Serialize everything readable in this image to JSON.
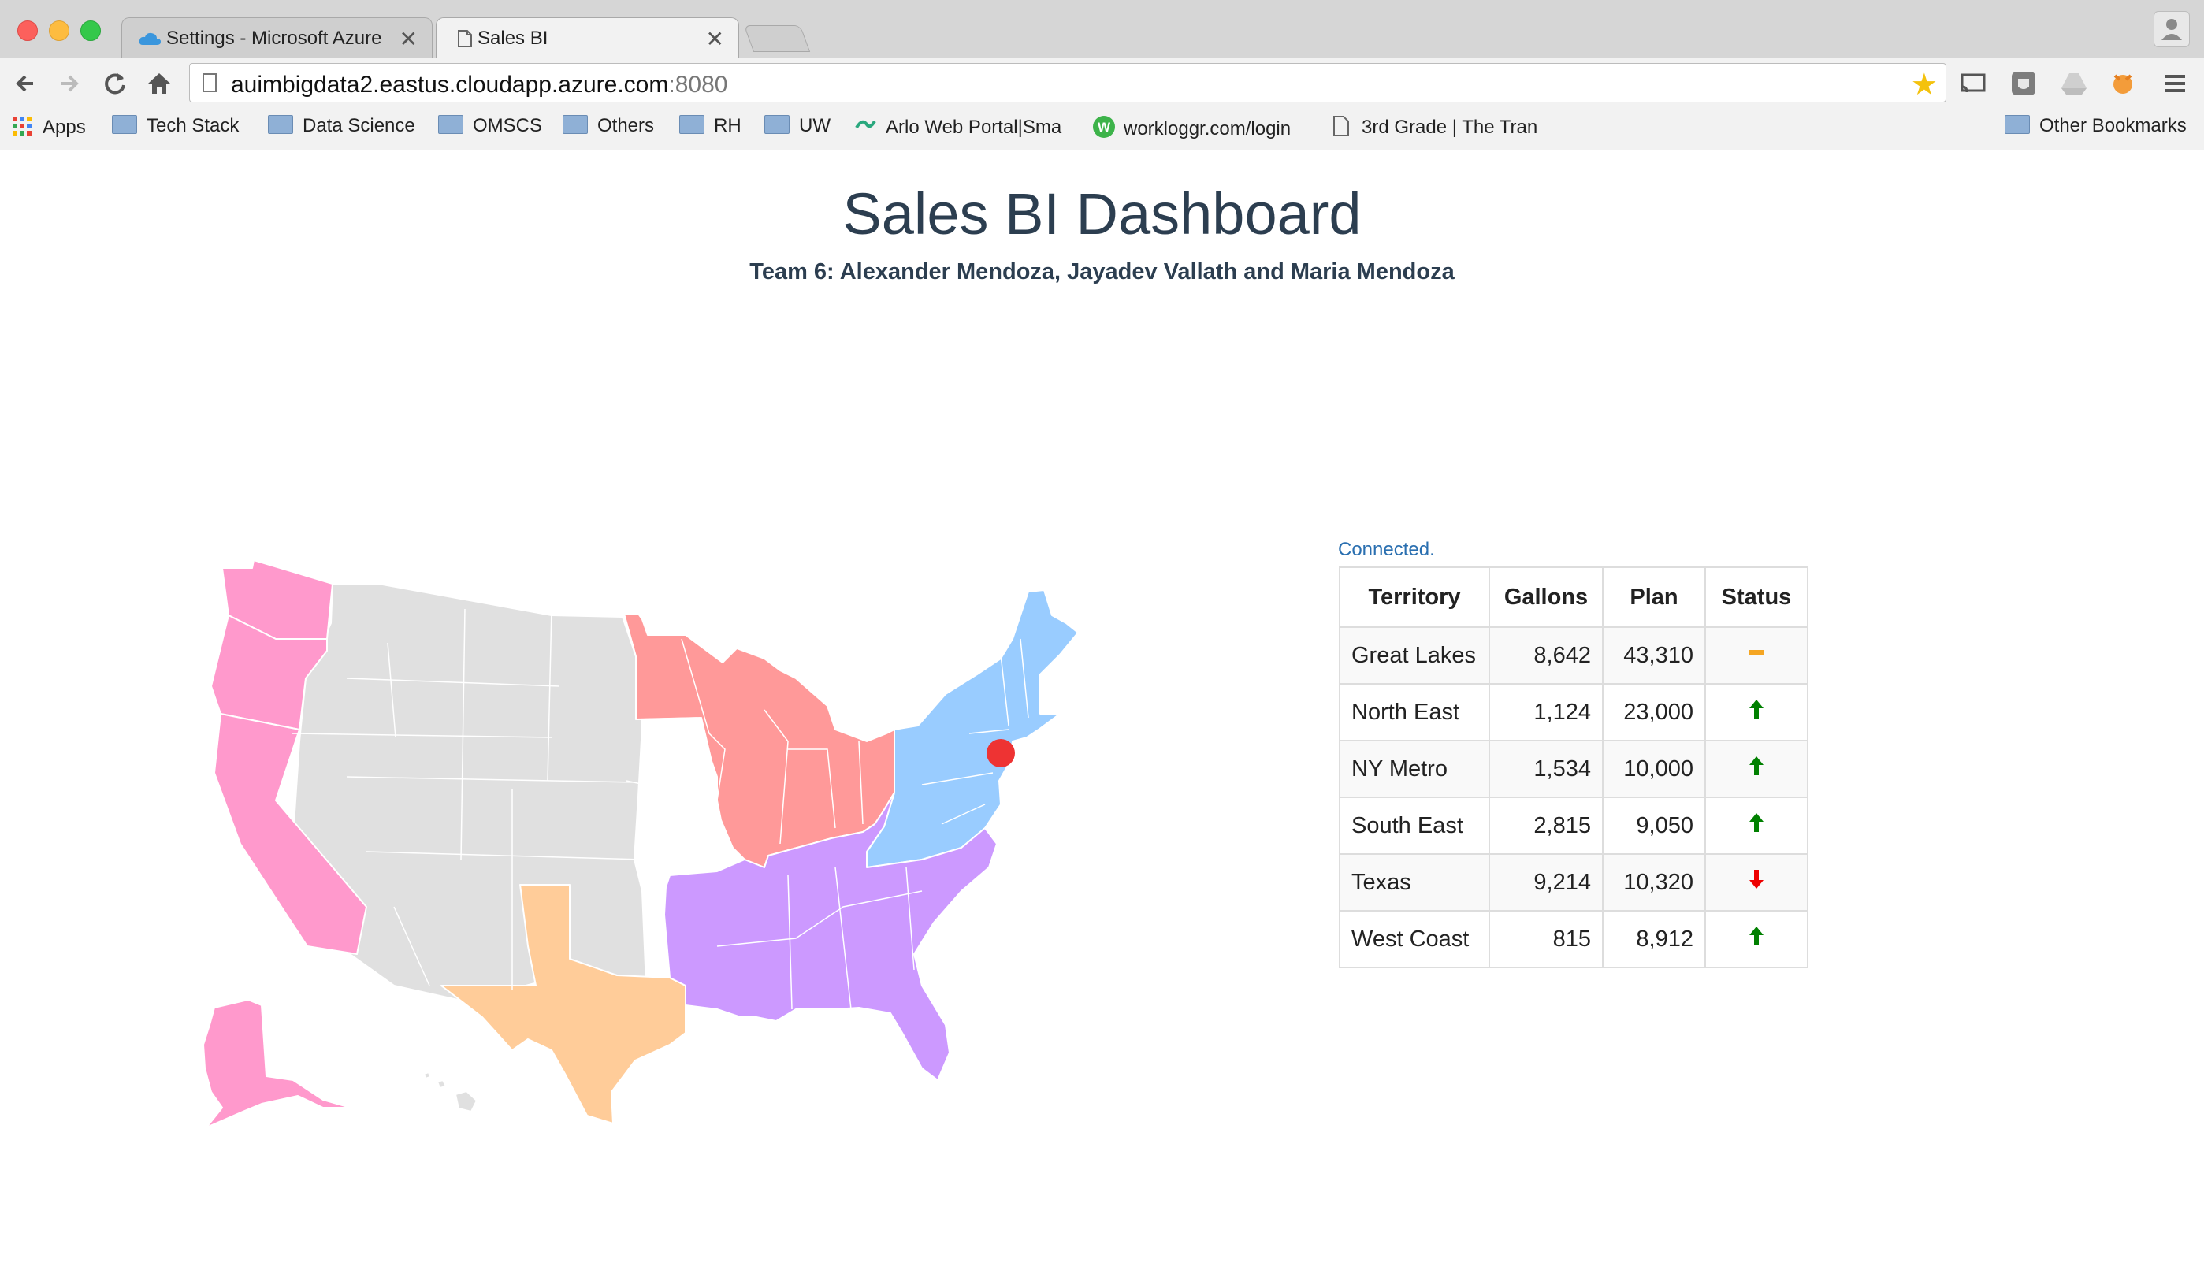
{
  "browser": {
    "tabs": [
      {
        "title": "Settings - Microsoft Azure",
        "close": "✕"
      },
      {
        "title": "Sales BI",
        "close": "✕"
      }
    ],
    "url": {
      "host": "auimbigdata2.eastus.cloudapp.azure.com",
      "port": ":8080"
    },
    "bookmarks": [
      {
        "label": "Apps",
        "icon": "apps-grid-icon"
      },
      {
        "label": "Tech Stack",
        "icon": "folder-icon"
      },
      {
        "label": "Data Science",
        "icon": "folder-icon"
      },
      {
        "label": "OMSCS",
        "icon": "folder-icon"
      },
      {
        "label": "Others",
        "icon": "folder-icon"
      },
      {
        "label": "RH",
        "icon": "folder-icon"
      },
      {
        "label": "UW",
        "icon": "folder-icon"
      },
      {
        "label": "Arlo Web Portal|Sma",
        "icon": "arlo-icon"
      },
      {
        "label": "workloggr.com/login",
        "icon": "workloggr-icon"
      },
      {
        "label": "3rd Grade | The Tran",
        "icon": "page-icon"
      },
      {
        "label": "Other Bookmarks",
        "icon": "folder-icon"
      }
    ]
  },
  "page": {
    "title": "Sales BI Dashboard",
    "subtitle": "Team 6: Alexander Mendoza, Jayadev Vallath and Maria Mendoza",
    "connection_status": "Connected."
  },
  "map": {
    "region_colors": {
      "west_coast": "#ff99cc",
      "great_lakes": "#ff9999",
      "north_east": "#99ccff",
      "south_east": "#cc99ff",
      "texas": "#ffcc99",
      "other": "#e0e0e0"
    },
    "marker_color": "#ee3333"
  },
  "table": {
    "headers": [
      "Territory",
      "Gallons",
      "Plan",
      "Status"
    ],
    "rows": [
      {
        "territory": "Great Lakes",
        "gallons": "8,642",
        "plan": "43,310",
        "status": "neutral"
      },
      {
        "territory": "North East",
        "gallons": "1,124",
        "plan": "23,000",
        "status": "up"
      },
      {
        "territory": "NY Metro",
        "gallons": "1,534",
        "plan": "10,000",
        "status": "up"
      },
      {
        "territory": "South East",
        "gallons": "2,815",
        "plan": "9,050",
        "status": "up"
      },
      {
        "territory": "Texas",
        "gallons": "9,214",
        "plan": "10,320",
        "status": "down"
      },
      {
        "territory": "West Coast",
        "gallons": "815",
        "plan": "8,912",
        "status": "up"
      }
    ],
    "status_colors": {
      "up": "#008000",
      "down": "#ee0000",
      "neutral": "#f5a623"
    }
  }
}
